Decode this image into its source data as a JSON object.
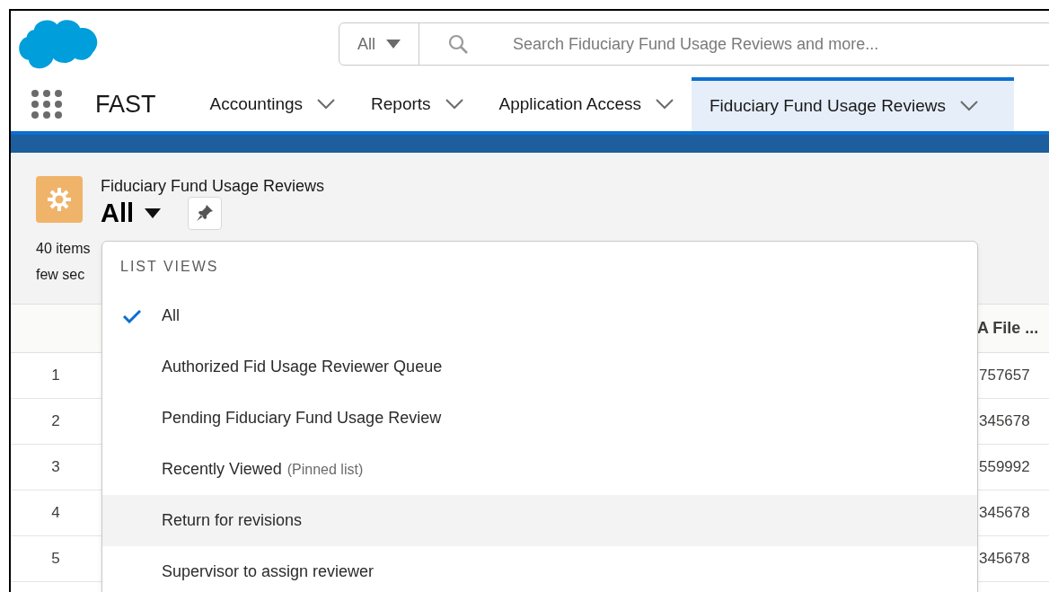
{
  "search": {
    "scope": "All",
    "placeholder": "Search Fiduciary Fund Usage Reviews and more..."
  },
  "app_name": "FAST",
  "nav_tabs": [
    {
      "label": "Accountings",
      "selected": false
    },
    {
      "label": "Reports",
      "selected": false
    },
    {
      "label": "Application Access",
      "selected": false
    },
    {
      "label": "Fiduciary Fund Usage Reviews",
      "selected": true
    }
  ],
  "list_header": {
    "object": "Fiduciary Fund Usage Reviews",
    "view": "All",
    "item_count": "40 items",
    "updated": "few sec"
  },
  "table": {
    "column_header": "A File ...",
    "rows": [
      {
        "number": "1",
        "file": "757657"
      },
      {
        "number": "2",
        "file": "345678"
      },
      {
        "number": "3",
        "file": "559992"
      },
      {
        "number": "4",
        "file": "345678"
      },
      {
        "number": "5",
        "file": "345678"
      }
    ]
  },
  "list_views_menu": {
    "heading": "LIST VIEWS",
    "items": [
      {
        "label": "All",
        "selected": true,
        "highlighted": false
      },
      {
        "label": "Authorized Fid Usage Reviewer Queue",
        "selected": false,
        "highlighted": false
      },
      {
        "label": "Pending Fiduciary Fund Usage Review",
        "selected": false,
        "highlighted": false
      },
      {
        "label": "Recently Viewed",
        "note": "(Pinned list)",
        "selected": false,
        "highlighted": false
      },
      {
        "label": "Return for revisions",
        "selected": false,
        "highlighted": true
      },
      {
        "label": "Supervisor to assign reviewer",
        "selected": false,
        "highlighted": false
      }
    ]
  }
}
